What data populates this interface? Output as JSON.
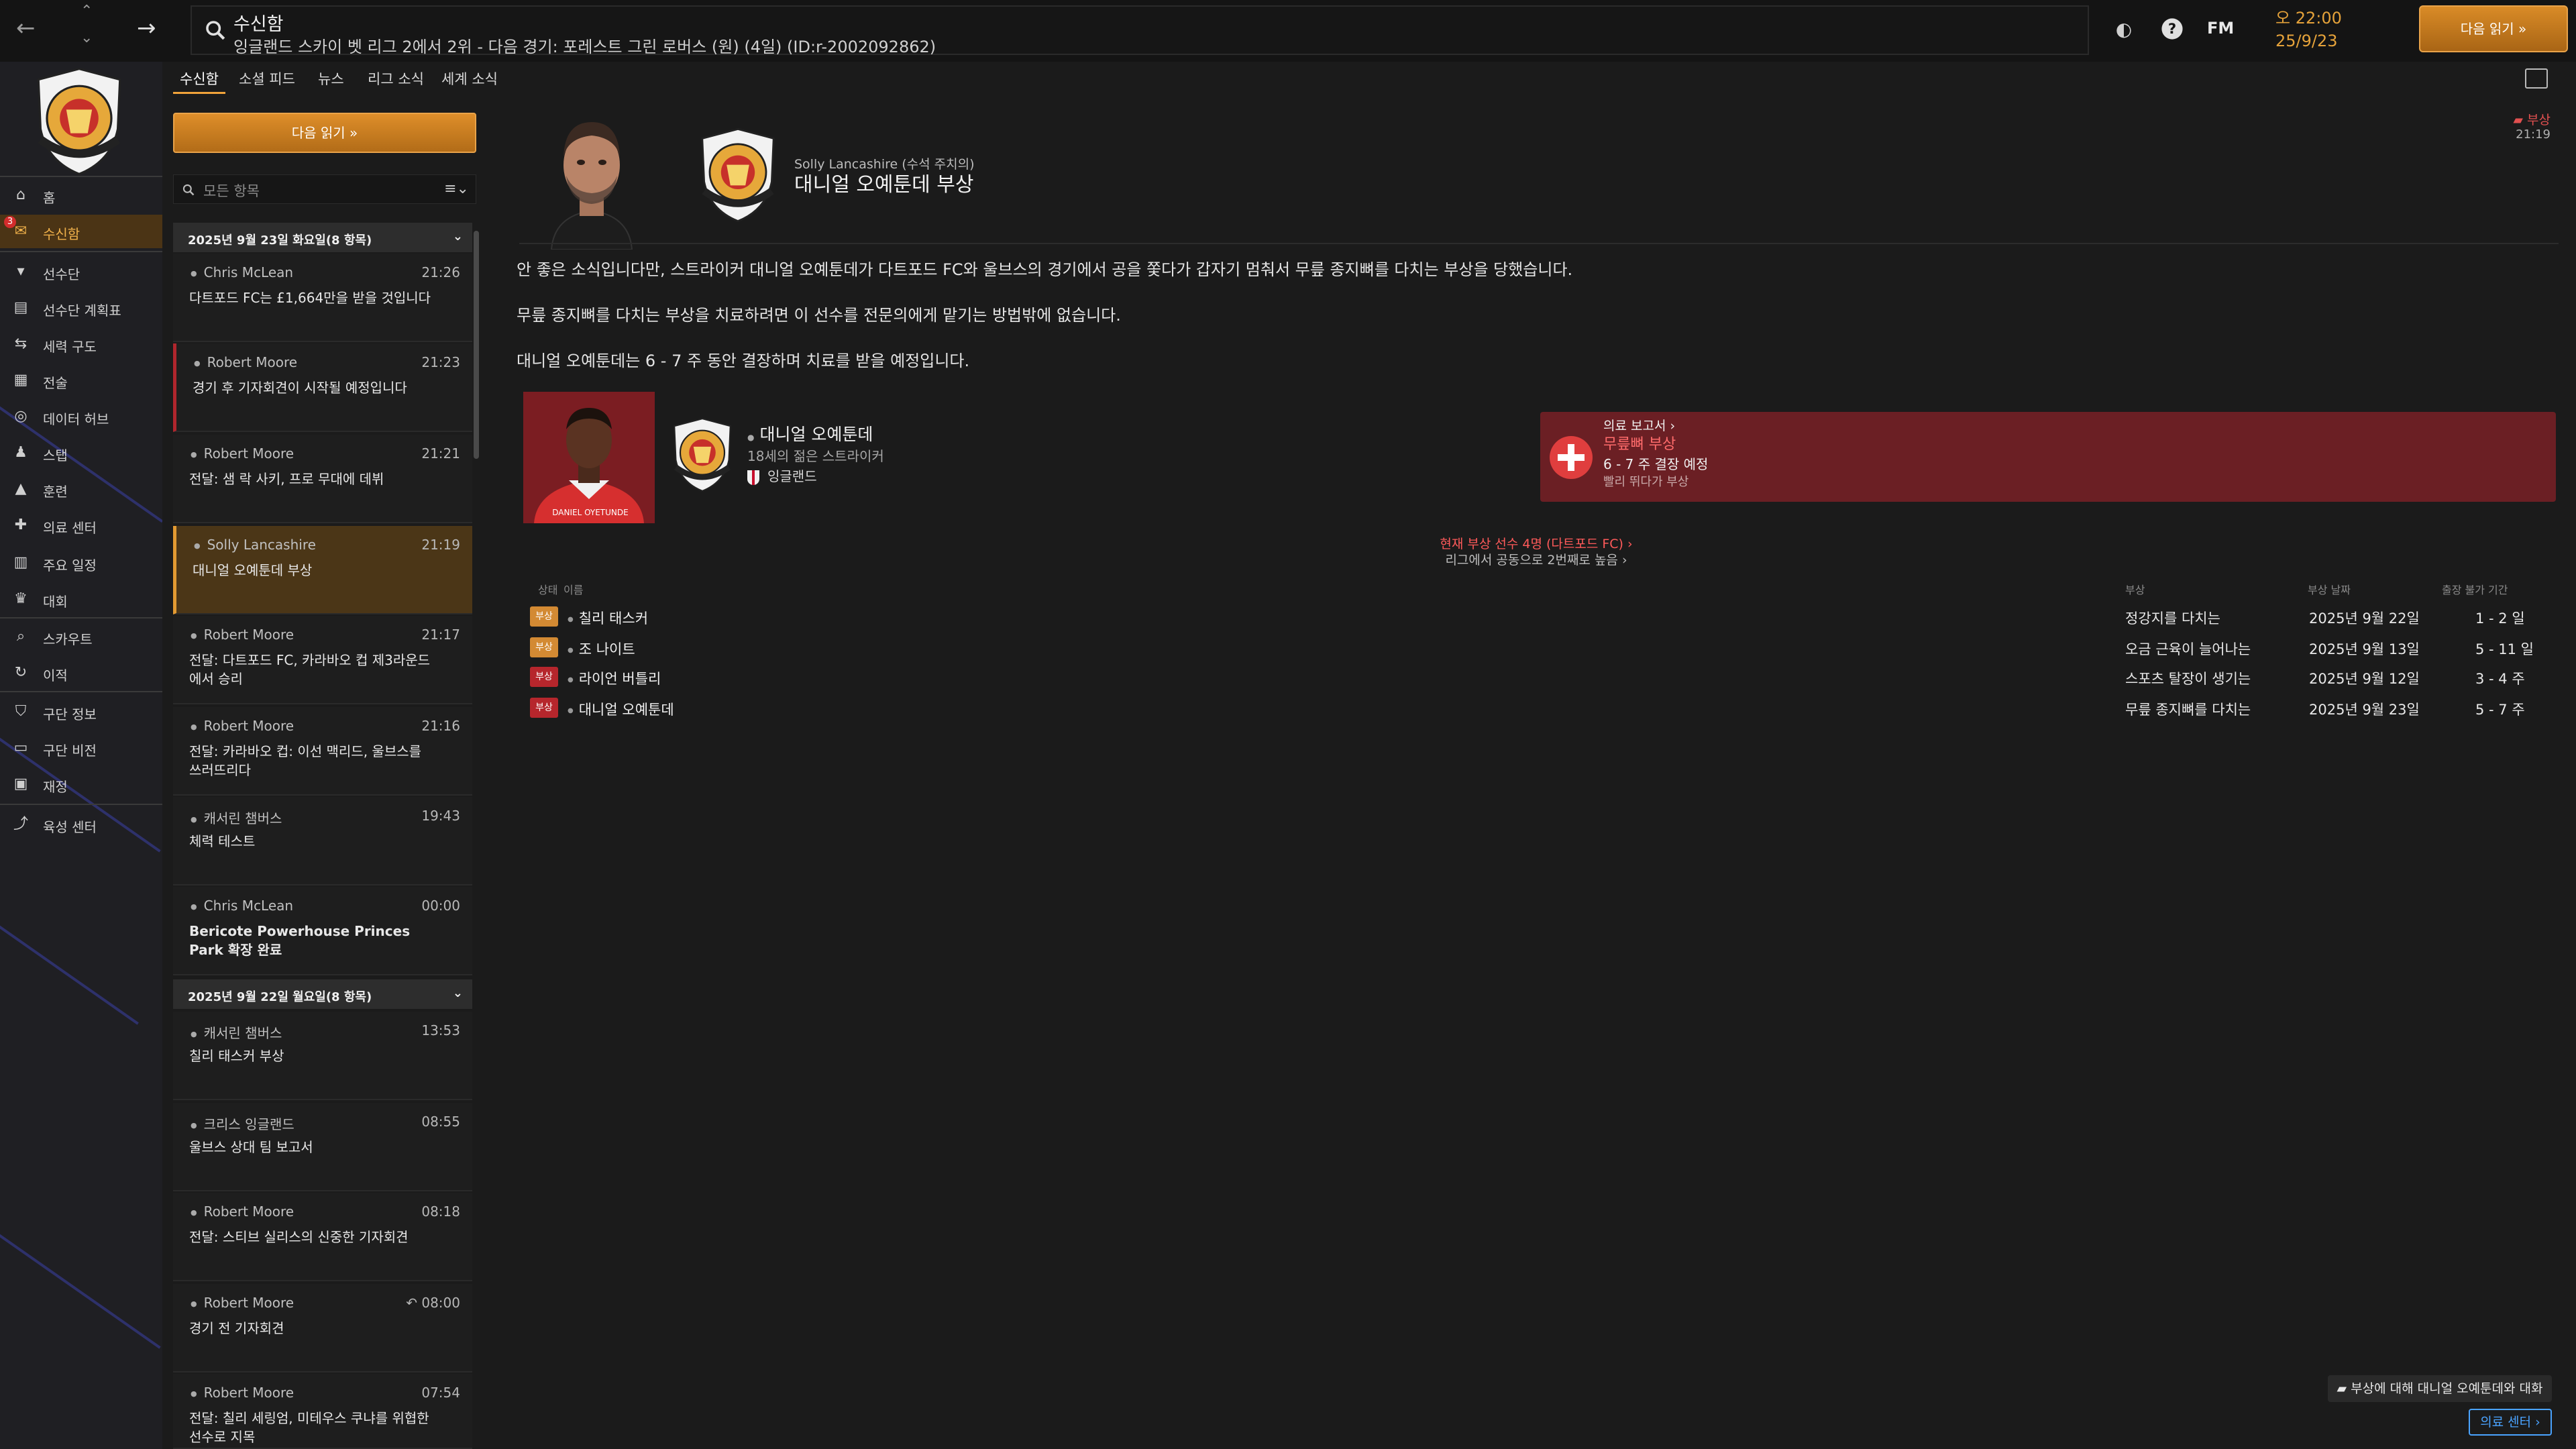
{
  "topbar": {
    "title": "수신함",
    "subtitle": "잉글랜드 스카이 벳 리그 2에서 2위 - 다음 경기: 포레스트 그린 로버스 (원) (4일) (ID:r-2002092862)",
    "fm_label": "FM",
    "clock_time": "오 22:00",
    "clock_date": "25/9/23",
    "continue_label": "다음 읽기 »"
  },
  "sidebar": {
    "items": [
      {
        "label": "홈",
        "icon": "home-icon"
      },
      {
        "label": "수신함",
        "icon": "inbox-icon",
        "badge": "3"
      },
      {
        "label": "선수단",
        "icon": "shirt-icon"
      },
      {
        "label": "선수단 계획표",
        "icon": "clipboard-icon"
      },
      {
        "label": "세력 구도",
        "icon": "dynamics-icon"
      },
      {
        "label": "전술",
        "icon": "tactics-icon"
      },
      {
        "label": "데이터 허브",
        "icon": "data-icon"
      },
      {
        "label": "스탭",
        "icon": "staff-icon"
      },
      {
        "label": "훈련",
        "icon": "training-icon"
      },
      {
        "label": "의료 센터",
        "icon": "medical-icon"
      },
      {
        "label": "주요 일정",
        "icon": "calendar-icon"
      },
      {
        "label": "대회",
        "icon": "trophy-icon"
      },
      {
        "label": "스카우트",
        "icon": "scout-icon"
      },
      {
        "label": "이적",
        "icon": "transfer-icon"
      },
      {
        "label": "구단 정보",
        "icon": "club-info-icon"
      },
      {
        "label": "구단 비전",
        "icon": "vision-icon"
      },
      {
        "label": "재정",
        "icon": "finance-icon"
      },
      {
        "label": "육성 센터",
        "icon": "development-icon"
      }
    ]
  },
  "tabs": [
    "수신함",
    "소셜 피드",
    "뉴스",
    "리그 소식",
    "세계 소식"
  ],
  "inbox": {
    "continue_label": "다음 읽기 »",
    "filter_placeholder": "모든 항목",
    "groups": [
      {
        "date": "2025년 9월 23일 화요일(8 항목)",
        "messages": [
          {
            "sender": "Chris McLean",
            "time": "21:26",
            "subject": "다트포드 FC는 £1,664만을 받을 것입니다"
          },
          {
            "sender": "Robert Moore",
            "time": "21:23",
            "subject": "경기 후 기자회견이 시작될 예정입니다"
          },
          {
            "sender": "Robert Moore",
            "time": "21:21",
            "subject": "전달: 샘 락 사키, 프로 무대에 데뷔"
          },
          {
            "sender": "Solly Lancashire",
            "time": "21:19",
            "subject": "대니얼 오예툰데 부상"
          },
          {
            "sender": "Robert Moore",
            "time": "21:17",
            "subject": "전달: 다트포드 FC, 카라바오 컵 제3라운드에서 승리"
          },
          {
            "sender": "Robert Moore",
            "time": "21:16",
            "subject": "전달: 카라바오 컵: 이선 맥리드, 울브스를 쓰러뜨리다"
          },
          {
            "sender": "캐서린 챔버스",
            "time": "19:43",
            "subject": "체력 테스트"
          },
          {
            "sender": "Chris McLean",
            "time": "00:00",
            "subject": "Bericote Powerhouse Princes Park 확장 완료"
          }
        ]
      },
      {
        "date": "2025년 9월 22일 월요일(8 항목)",
        "messages": [
          {
            "sender": "캐서린 챔버스",
            "time": "13:53",
            "subject": "칠리 태스커 부상"
          },
          {
            "sender": "크리스 잉글랜드",
            "time": "08:55",
            "subject": "울브스 상대 팀 보고서"
          },
          {
            "sender": "Robert Moore",
            "time": "08:18",
            "subject": "전달: 스티브 실리스의 신중한 기자회견"
          },
          {
            "sender": "Robert Moore",
            "time": "↶ 08:00",
            "subject": "경기 전 기자회견"
          },
          {
            "sender": "Robert Moore",
            "time": "07:54",
            "subject": "전달: 칠리 세링엄, 미테우스 쿠냐를 위협한 선수로 지목"
          }
        ]
      }
    ]
  },
  "article": {
    "byline": "Solly Lancashire (수석 주치의)",
    "headline": "대니얼 오예툰데 부상",
    "tag": "부상",
    "tag_time": "21:19",
    "paragraphs": [
      "안 좋은 소식입니다만, 스트라이커 대니얼 오예툰데가 다트포드 FC와 울브스의 경기에서 공을 쫓다가 갑자기 멈춰서 무릎 종지뼈를 다치는 부상을 당했습니다.",
      "무릎 종지뼈를 다치는 부상을 치료하려면 이 선수를 전문의에게 맡기는 방법밖에 없습니다.",
      "대니얼 오예툰데는 6 - 7 주 동안 결장하며 치료를 받을 예정입니다."
    ],
    "player": {
      "name": "대니얼 오예툰데",
      "age_line": "18세의 젊은 스트라이커",
      "nation": "잉글랜드",
      "shirt_name": "DANIEL OYETUNDE"
    },
    "medical": {
      "link": "의료 보고서 ›",
      "injury": "무릎뼈 부상",
      "duration": "6 - 7 주 결장 예정",
      "note": "빨리 뛰다가 부상"
    },
    "summary_line1": "현재 부상 선수 4명 (다트포드 FC) ›",
    "summary_line2": "리그에서 공동으로 2번째로 높음 ›",
    "table": {
      "headers": {
        "status": "상태",
        "name": "이름",
        "injury": "부상",
        "date": "부상 날짜",
        "out": "출장 불가 기간"
      },
      "rows": [
        {
          "badge": "부상",
          "badge_color": "orange",
          "name": "칠리 태스커",
          "injury": "정강지를 다치는",
          "date": "2025년 9월 22일",
          "out": "1 - 2 일"
        },
        {
          "badge": "부상",
          "badge_color": "orange",
          "name": "조 나이트",
          "injury": "오금 근육이 늘어나는",
          "date": "2025년 9월 13일",
          "out": "5 - 11 일"
        },
        {
          "badge": "부상",
          "badge_color": "red",
          "name": "라이언 버틀리",
          "injury": "스포츠 탈장이 생기는",
          "date": "2025년 9월 12일",
          "out": "3 - 4 주"
        },
        {
          "badge": "부상",
          "badge_color": "red",
          "name": "대니얼 오예툰데",
          "injury": "무릎 종지뼈를 다치는",
          "date": "2025년 9월 23일",
          "out": "5 - 7 주"
        }
      ]
    },
    "discuss_label": "부상에 대해 대니얼 오예툰데와 대화",
    "medcenter_label": "의료 센터 ›"
  },
  "colors": {
    "accent": "#e39a32",
    "injury_red": "#b6262c",
    "minor_orange": "#d38a33",
    "background": "#1b1b1b"
  }
}
